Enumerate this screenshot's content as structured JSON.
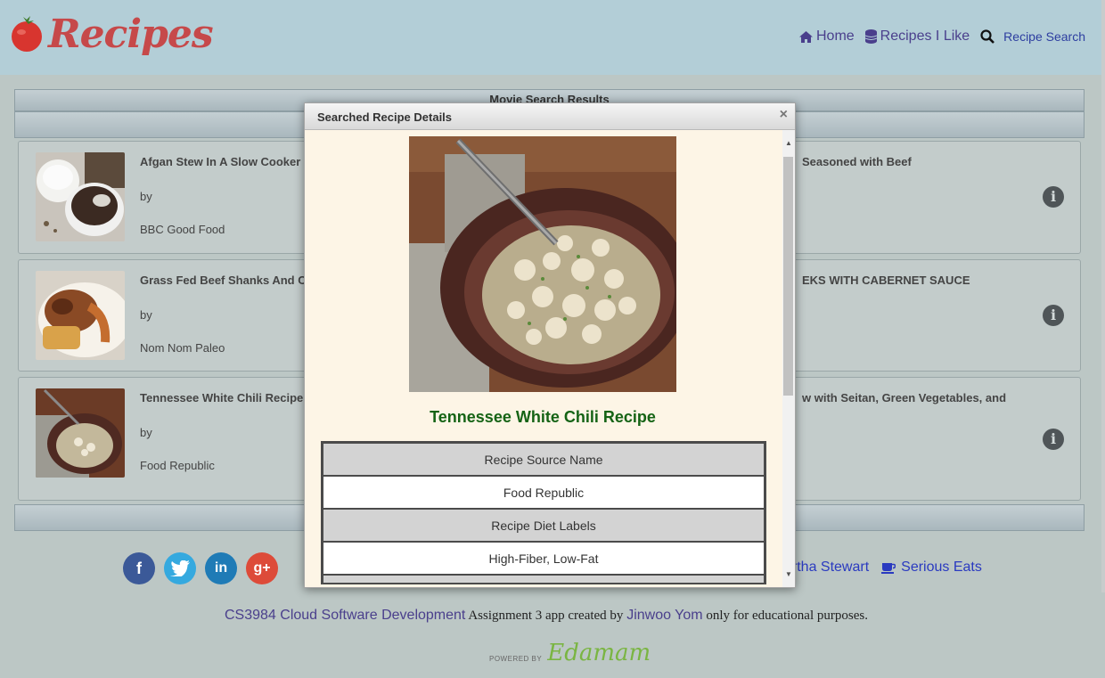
{
  "app": {
    "title": "Recipes"
  },
  "nav": {
    "home": "Home",
    "recipes_i_like": "Recipes I Like",
    "recipe_search": "Recipe Search"
  },
  "background": {
    "panel_title": "Movie Search Results",
    "cards": [
      {
        "title": "Afgan Stew In A Slow Cooker",
        "by": "by",
        "source": "BBC Good Food",
        "right_title": "Seasoned with Beef"
      },
      {
        "title": "Grass Fed Beef Shanks And C",
        "by": "by",
        "source": "Nom Nom Paleo",
        "right_title": "EKS WITH CABERNET SAUCE"
      },
      {
        "title": "Tennessee White Chili Recipe",
        "by": "by",
        "source": "Food Republic",
        "right_title": "w with Seitan, Green Vegetables, and"
      }
    ]
  },
  "footer": {
    "partners": [
      "artha Stewart",
      "Serious Eats"
    ],
    "course_link": "CS3984 Cloud Software Development",
    "credit_mid": "Assignment 3 app created by",
    "author_link": "Jinwoo Yom",
    "credit_end": "only for educational purposes.",
    "powered_by": "POWERED BY",
    "powered_brand": "Edamam"
  },
  "modal": {
    "title": "Searched Recipe Details",
    "close": "×",
    "recipe_name": "Tennessee White Chili Recipe",
    "rows": [
      {
        "label": "Recipe Source Name",
        "value": "Food Republic"
      },
      {
        "label": "Recipe Diet Labels",
        "value": "High-Fiber, Low-Fat"
      }
    ]
  },
  "colors": {
    "header_bg": "#b3ced7",
    "brand_red": "#c6494a",
    "recipe_name_green": "#156315",
    "nav_link": "#4a3f8c"
  }
}
